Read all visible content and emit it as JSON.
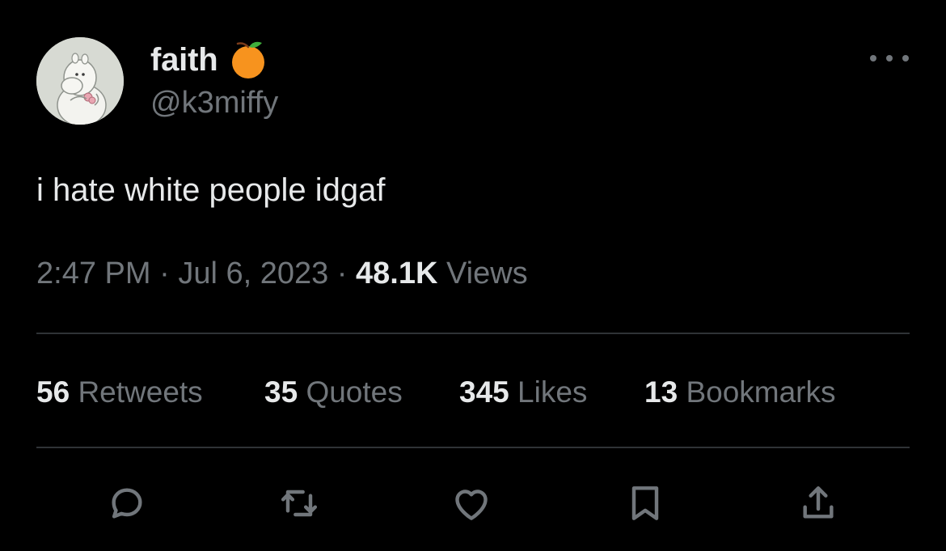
{
  "user": {
    "display_name": "faith",
    "handle": "@k3miffy",
    "badge_icon": "orange-fruit-icon",
    "avatar_icon": "moomin-avatar"
  },
  "more_icon": "more-options-icon",
  "tweet": {
    "text": "i hate white people idgaf",
    "time": "2:47 PM",
    "separator": "·",
    "date": "Jul 6, 2023",
    "views_count": "48.1K",
    "views_label": "Views"
  },
  "stats": {
    "retweets": {
      "count": "56",
      "label": "Retweets"
    },
    "quotes": {
      "count": "35",
      "label": "Quotes"
    },
    "likes": {
      "count": "345",
      "label": "Likes"
    },
    "bookmarks": {
      "count": "13",
      "label": "Bookmarks"
    }
  },
  "actions": [
    "reply-icon",
    "retweet-icon",
    "like-icon",
    "bookmark-icon",
    "share-icon"
  ],
  "colors": {
    "background": "#000000",
    "primary_text": "#e7e9ea",
    "secondary_text": "#71767b",
    "divider": "#2f3336",
    "badge_orange": "#f7931e"
  }
}
